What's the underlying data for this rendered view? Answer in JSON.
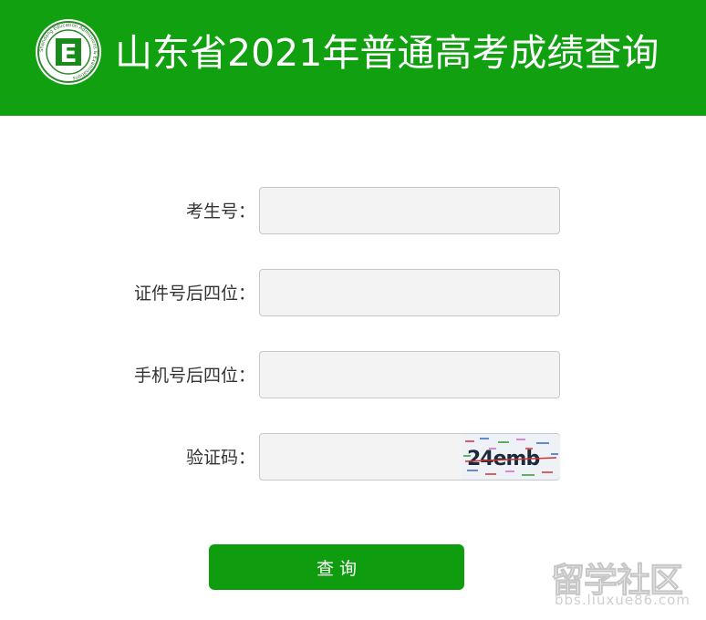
{
  "header": {
    "title": "山东省2021年普通高考成绩查询",
    "logo": {
      "icon": "exam-logo-emblem",
      "letter": "E",
      "ring_text": "Shandong Education Admissions & Examinations"
    }
  },
  "form": {
    "fields": [
      {
        "label": "考生号：",
        "value": "",
        "placeholder": ""
      },
      {
        "label": "证件号后四位：",
        "value": "",
        "placeholder": ""
      },
      {
        "label": "手机号后四位：",
        "value": "",
        "placeholder": ""
      },
      {
        "label": "验证码：",
        "value": "",
        "placeholder": ""
      }
    ],
    "captcha_text": "24emb",
    "submit_label": "查询"
  },
  "watermark": {
    "main": "留学社区",
    "sub": "bbs.liuxue86.com"
  },
  "colors": {
    "brand_green": "#10a010",
    "button_green": "#0f9d0f",
    "input_bg": "#f3f3f3"
  }
}
